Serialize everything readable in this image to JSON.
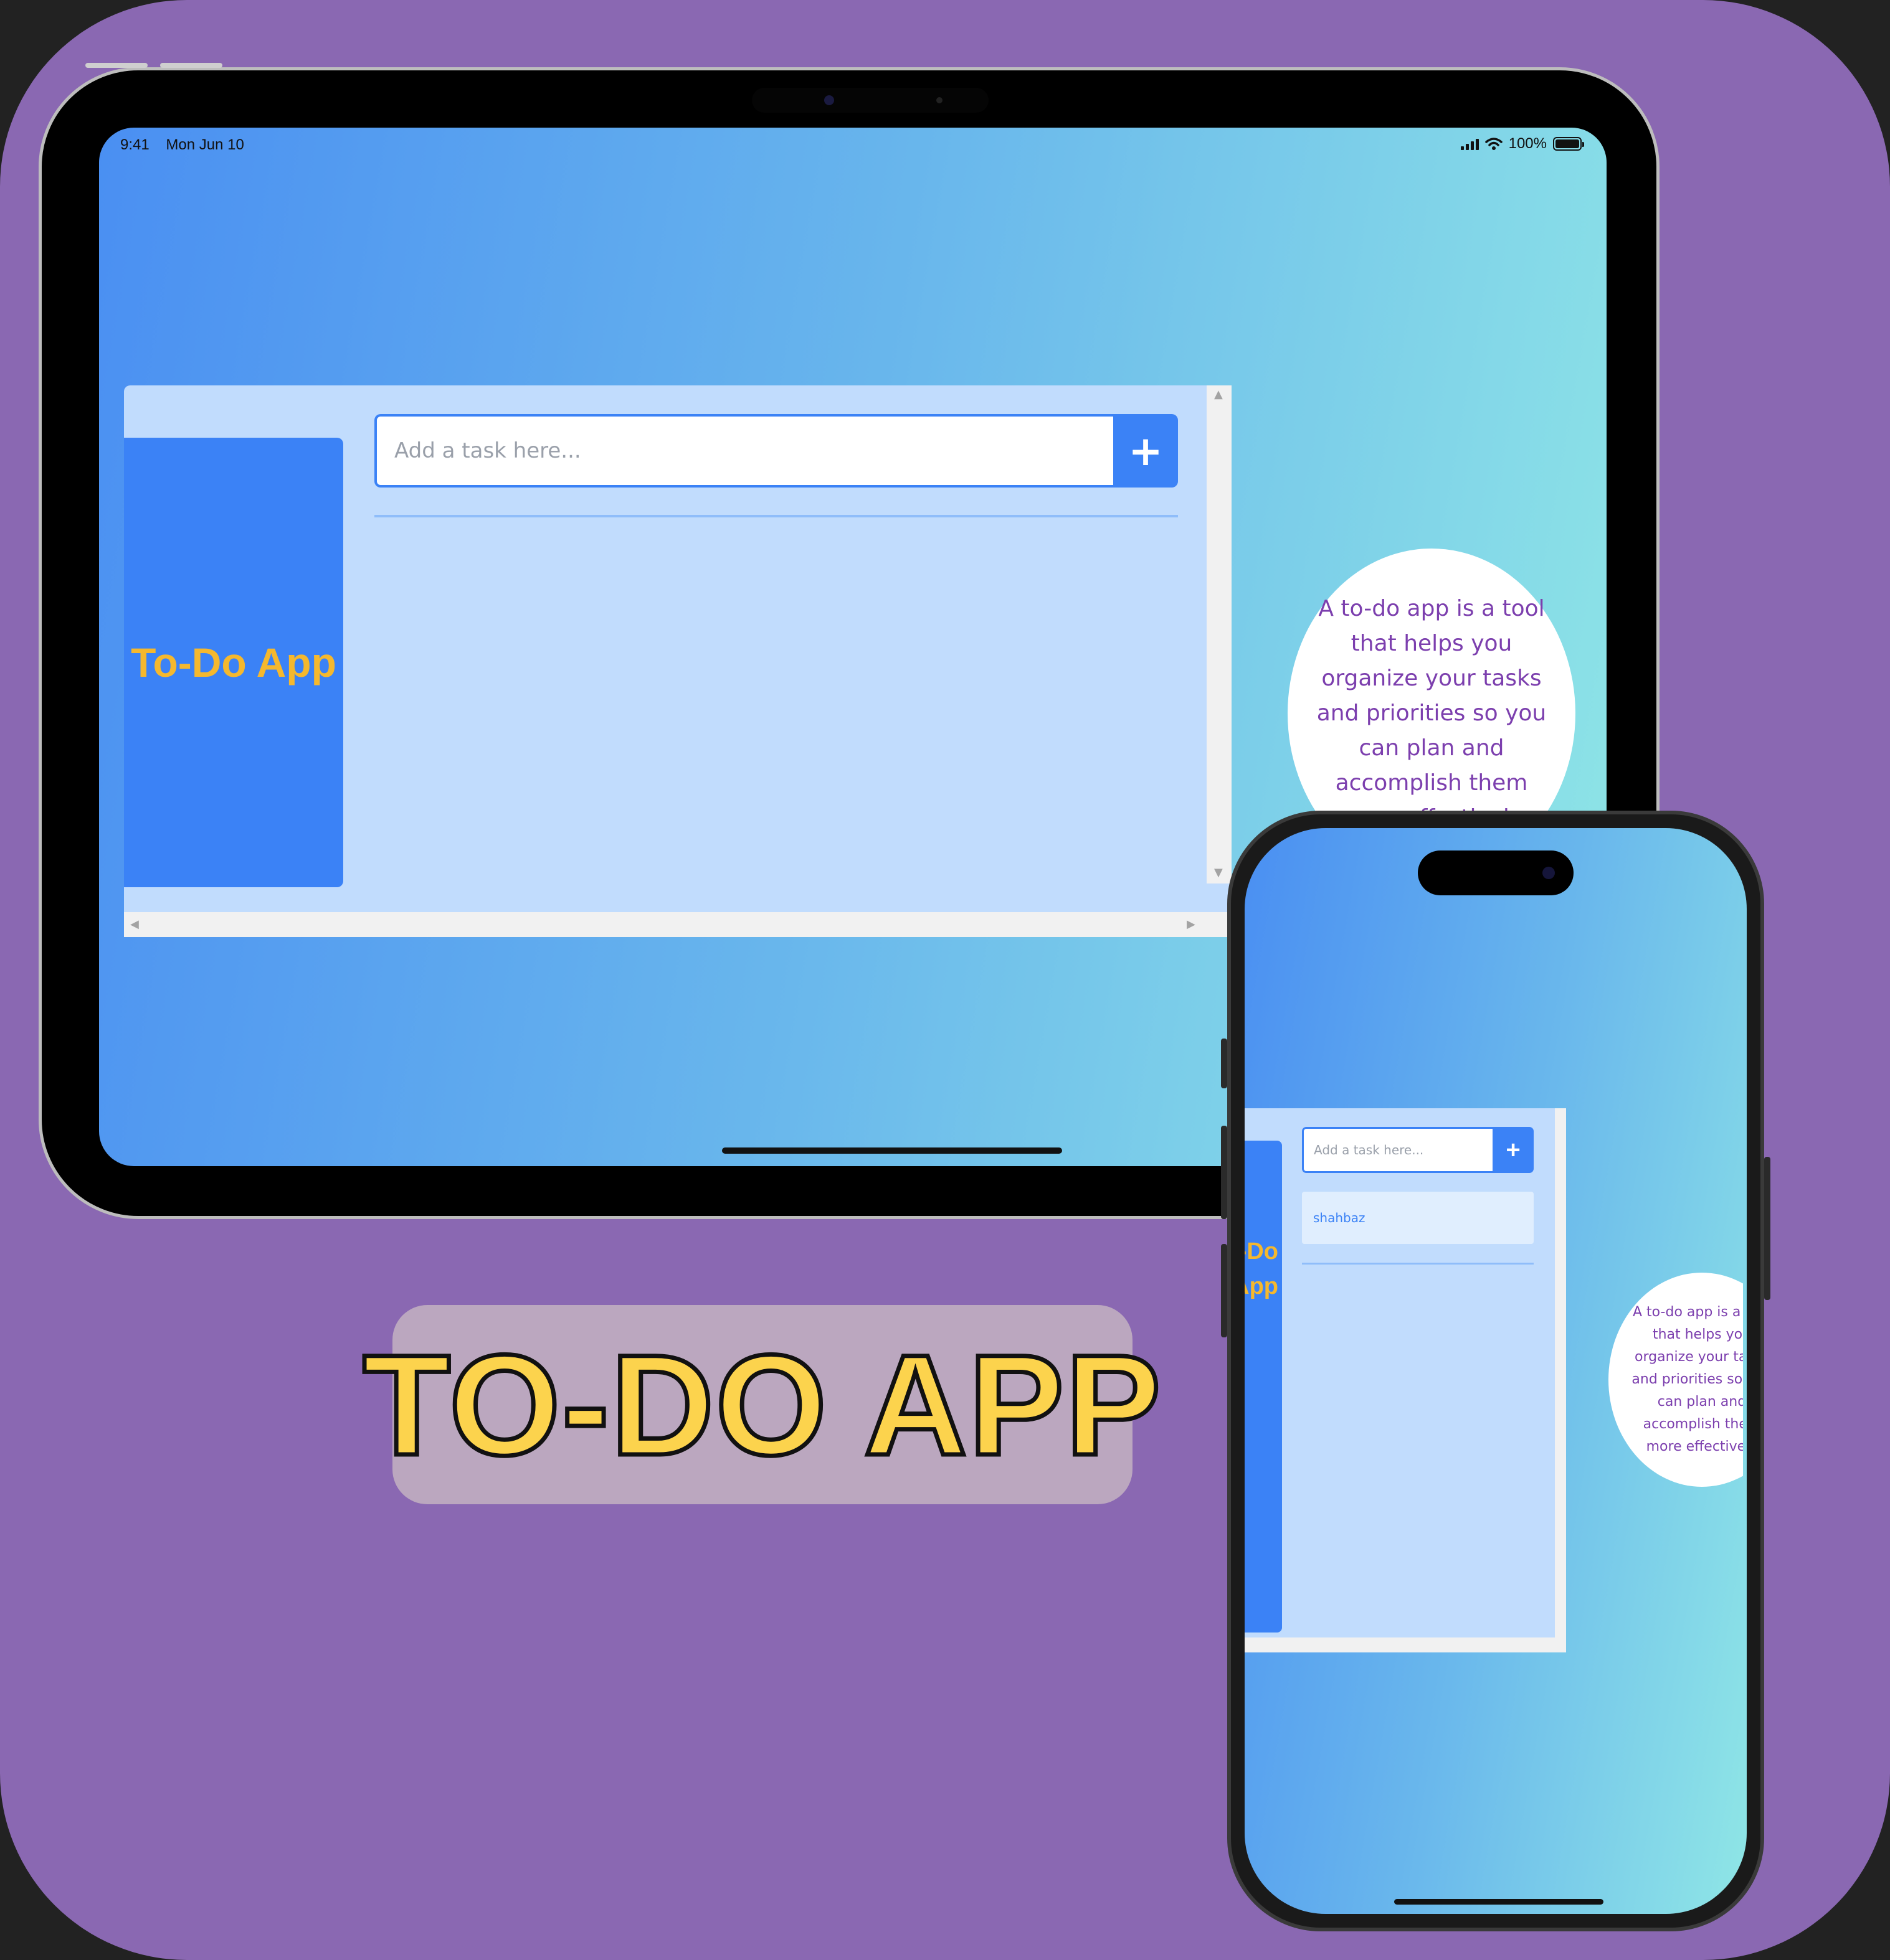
{
  "colors": {
    "background": "#8a68b2",
    "accent": "#3b82f6",
    "app_panel": "#c1dcfd",
    "sidebar_title": "#f5b82e",
    "info_text": "#7c3fae",
    "badge_bg": "#bba7bf",
    "badge_text": "#fcd34d"
  },
  "ipad": {
    "status_bar": {
      "time": "9:41",
      "date": "Mon Jun 10",
      "battery": "100%"
    },
    "app": {
      "title": "To-Do App",
      "input_placeholder": "Add a task here...",
      "add_button_label": "+",
      "tasks": []
    },
    "info": "A to-do app is a tool that helps you organize your tasks and priorities so you can plan and accomplish them more effectively"
  },
  "iphone": {
    "app": {
      "title": "To-Do App",
      "input_placeholder": "Add a task here...",
      "add_button_label": "+",
      "tasks": [
        "shahbaz"
      ]
    },
    "info": "A to-do app is a tool that helps you organize your tasks and priorities so you can plan and accomplish them more effectively"
  },
  "badge": {
    "label": "TO-DO APP"
  },
  "icons": {
    "signal": "signal-icon",
    "wifi": "wifi-icon",
    "battery": "battery-icon",
    "add": "plus-icon"
  }
}
